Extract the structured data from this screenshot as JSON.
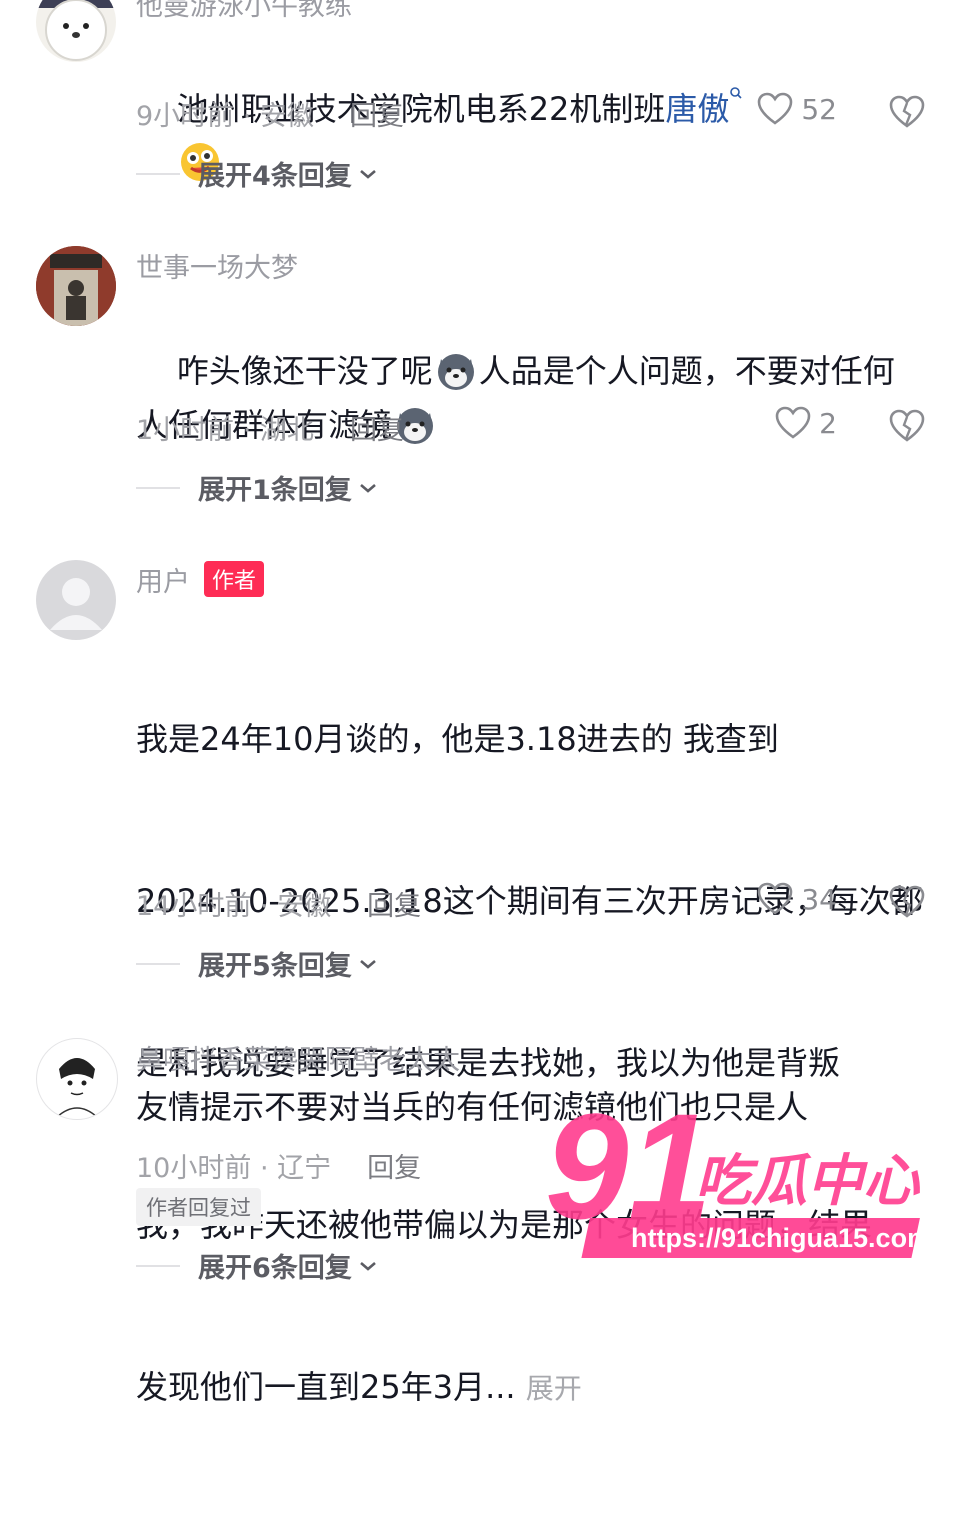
{
  "comments": [
    {
      "username": "他曼游泳小牛教练",
      "text": "池州职业技术学院机电系22机制班",
      "mention": "唐傲",
      "meta": "9小时前 · 安徽",
      "reply_label": "回复",
      "likes": "52",
      "expand_label": "展开4条回复",
      "avatar_icon": "bear-avatar-icon"
    },
    {
      "username": "世事一场大梦",
      "text_part1": "咋头像还干没了呢",
      "text_part2": "人品是个人问题，不要对任何",
      "text_part3": "人任何群体有滤镜",
      "meta": "1小时前 · 湖北",
      "reply_label": "回复",
      "likes": "2",
      "expand_label": "展开1条回复",
      "avatar_icon": "photo-avatar-icon"
    },
    {
      "username": "用户",
      "author_tag": "作者",
      "lines": [
        "我是24年10月谈的，他是3.18进去的 我查到",
        "2024.10-2025.3.18这个期间有三次开房记录，每次都",
        "是和我说要睡觉了结果是去找她，我以为他是背叛",
        "我，我昨天还被他带偏以为是那个女生的问题，结果",
        "发现他们一直到25年3月..."
      ],
      "more_label": "展开",
      "meta": "14小时前 · 安徽",
      "reply_label": "回复",
      "likes": "34",
      "expand_label": "展开5条回复",
      "avatar_icon": "default-avatar-icon"
    },
    {
      "username": "鼻嘎拌香菜馋哭隔壁老太太",
      "text": "友情提示不要对当兵的有任何滤镜他们也只是人",
      "meta": "10小时前 · 辽宁",
      "reply_label": "回复",
      "replied_tag": "作者回复过",
      "expand_label": "展开6条回复",
      "avatar_icon": "sketch-avatar-icon"
    }
  ],
  "watermark": {
    "number": "91",
    "text": "吃瓜中心",
    "url": "https://91chigua15.com"
  },
  "colors": {
    "accent": "#fe2c55",
    "mention": "#2b5aa8",
    "muted": "#a2a3a8"
  }
}
